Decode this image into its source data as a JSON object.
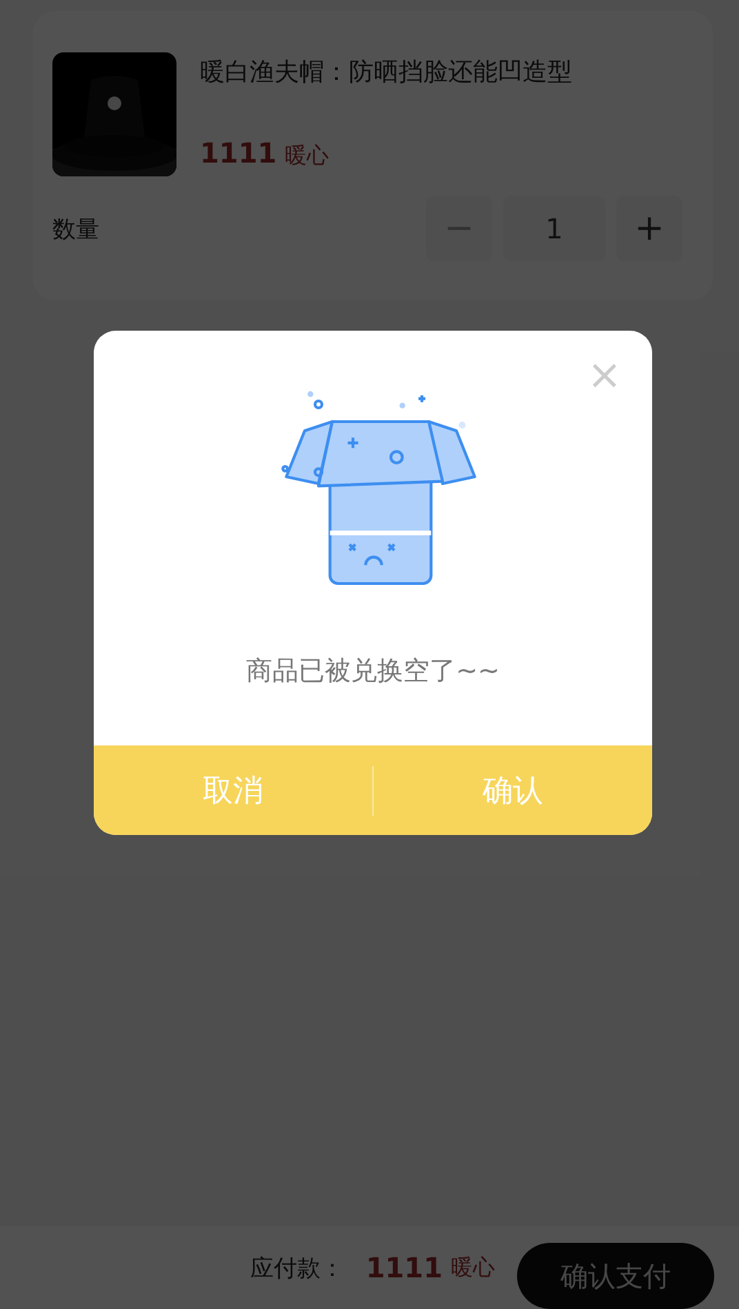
{
  "product": {
    "title": "暖白渔夫帽：防晒挡脸还能凹造型",
    "price_amount": "1111",
    "price_unit": "暖心"
  },
  "quantity": {
    "label": "数量",
    "minus": "−",
    "value": "1",
    "plus": "+",
    "minus_disabled": true
  },
  "dialog": {
    "close": "×",
    "message": "商品已被兑换空了~~",
    "buttons": [
      {
        "label": "取消"
      },
      {
        "label": "确认"
      }
    ]
  },
  "footer": {
    "label": "应付款：",
    "amount": "1111",
    "unit": "暖心",
    "button": "确认支付"
  }
}
